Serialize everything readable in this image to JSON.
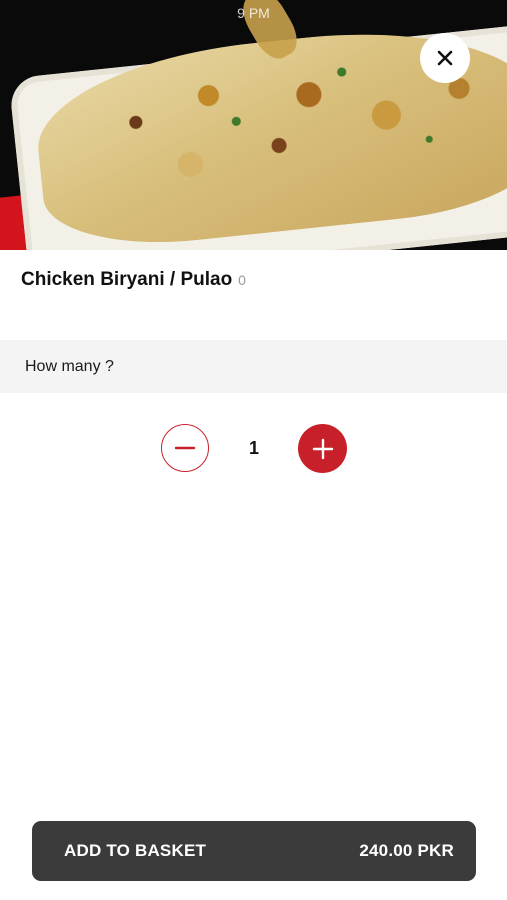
{
  "status_bar": {
    "time": "9 PM"
  },
  "hero": {
    "image_alt": "Chicken Biryani / Pulao"
  },
  "product": {
    "title": "Chicken Biryani / Pulao",
    "count": "0"
  },
  "quantity_section": {
    "header": "How many ?",
    "value": "1"
  },
  "footer": {
    "button_label": "ADD TO BASKET",
    "price": "240.00 PKR"
  },
  "icons": {
    "close": "close-icon",
    "minus": "minus-icon",
    "plus": "plus-icon"
  },
  "colors": {
    "accent": "#c8202a",
    "button_bg": "#3b3b3b",
    "section_bg": "#f4f4f4"
  }
}
